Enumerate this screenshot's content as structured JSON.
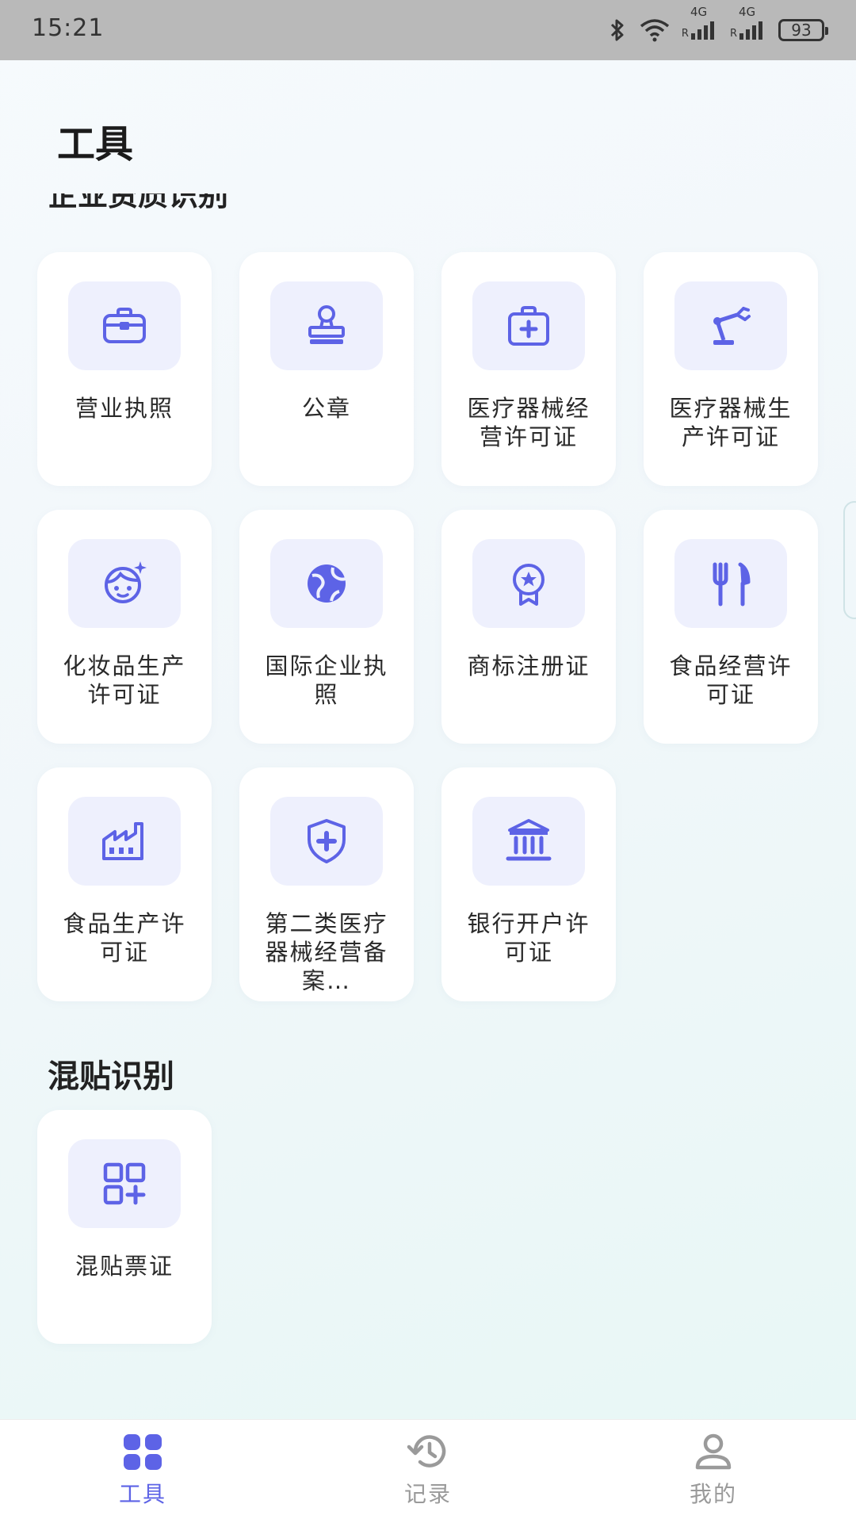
{
  "status_bar": {
    "time": "15:21",
    "network_1": "4G",
    "network_2": "4G",
    "roaming_1": "R",
    "roaming_2": "R",
    "battery": "93"
  },
  "page": {
    "title": "工具"
  },
  "sections": [
    {
      "title": "企业资质识别",
      "cards": [
        {
          "label": "营业执照",
          "icon": "briefcase-icon"
        },
        {
          "label": "公章",
          "icon": "stamp-icon"
        },
        {
          "label": "医疗器械经营许可证",
          "icon": "medical-kit-icon"
        },
        {
          "label": "医疗器械生产许可证",
          "icon": "robotic-arm-icon"
        },
        {
          "label": "化妆品生产许可证",
          "icon": "face-sparkle-icon"
        },
        {
          "label": "国际企业执照",
          "icon": "globe-icon"
        },
        {
          "label": "商标注册证",
          "icon": "award-badge-icon"
        },
        {
          "label": "食品经营许可证",
          "icon": "fork-knife-icon"
        },
        {
          "label": "食品生产许可证",
          "icon": "factory-icon"
        },
        {
          "label": "第二类医疗器械经营备案…",
          "icon": "shield-plus-icon"
        },
        {
          "label": "银行开户许可证",
          "icon": "bank-icon"
        }
      ]
    },
    {
      "title": "混贴识别",
      "cards": [
        {
          "label": "混贴票证",
          "icon": "grid-plus-icon"
        }
      ]
    }
  ],
  "tabbar": {
    "tabs": [
      {
        "label": "工具",
        "icon": "grid-icon",
        "active": true
      },
      {
        "label": "记录",
        "icon": "history-icon",
        "active": false
      },
      {
        "label": "我的",
        "icon": "user-icon",
        "active": false
      }
    ]
  },
  "colors": {
    "accent": "#5d63e6",
    "icon_bg": "#eef0fd",
    "inactive": "#9a9a9a"
  }
}
